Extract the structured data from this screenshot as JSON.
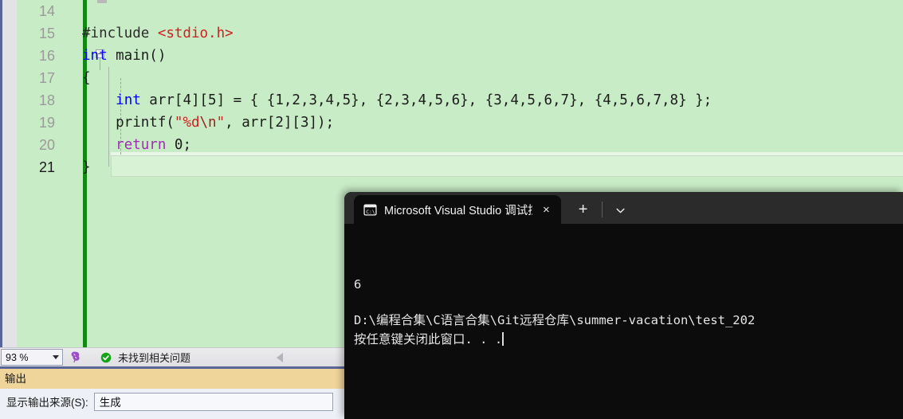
{
  "editor": {
    "name": "visual-studio-code-editor",
    "background_color": "#c8ecc5",
    "change_bar_color": "#128a12",
    "lines": [
      {
        "number": "14",
        "active": false,
        "tokens": []
      },
      {
        "number": "15",
        "active": false,
        "tokens": [
          {
            "t": "#include ",
            "c": "pp"
          },
          {
            "t": "<stdio.h>",
            "c": "red"
          }
        ]
      },
      {
        "number": "16",
        "active": false,
        "tokens": [
          {
            "t": "int",
            "c": "blue"
          },
          {
            "t": " main()",
            "c": "plain"
          }
        ]
      },
      {
        "number": "17",
        "active": false,
        "tokens": [
          {
            "t": "{",
            "c": "plain"
          }
        ]
      },
      {
        "number": "18",
        "active": false,
        "tokens": [
          {
            "t": "    ",
            "c": "plain"
          },
          {
            "t": "int",
            "c": "blue"
          },
          {
            "t": " arr[4][5] = { {1,2,3,4,5}, {2,3,4,5,6}, {3,4,5,6,7}, {4,5,6,7,8} };",
            "c": "plain"
          }
        ]
      },
      {
        "number": "19",
        "active": false,
        "tokens": [
          {
            "t": "    printf(",
            "c": "plain"
          },
          {
            "t": "\"%d",
            "c": "red"
          },
          {
            "t": "\\n",
            "c": "esc"
          },
          {
            "t": "\"",
            "c": "red"
          },
          {
            "t": ", arr[2][3]);",
            "c": "plain"
          }
        ]
      },
      {
        "number": "20",
        "active": false,
        "tokens": [
          {
            "t": "    ",
            "c": "plain"
          },
          {
            "t": "return",
            "c": "purple"
          },
          {
            "t": " 0;",
            "c": "plain"
          }
        ]
      },
      {
        "number": "21",
        "active": true,
        "tokens": [
          {
            "t": "}",
            "c": "plain"
          }
        ]
      }
    ]
  },
  "statusbar": {
    "zoom_value": "93 %",
    "brain_icon": "intellicode-brain-icon",
    "status_icon": "green-check-circle-icon",
    "status_text": "未找到相关问题",
    "nav_arrow_icon": "left-triangle-icon"
  },
  "output_panel": {
    "tab_label": "输出",
    "tab_color": "#f0d59a",
    "source_label": "显示输出来源(S):",
    "source_value": "生成"
  },
  "console": {
    "tab_icon": "command-prompt-icon",
    "tab_title": "Microsoft Visual Studio 调试控",
    "close_icon": "×",
    "new_tab_icon": "+",
    "dropdown_icon": "chevron-down-icon",
    "output_lines": [
      "6",
      "",
      "D:\\编程合集\\C语言合集\\Git远程仓库\\summer-vacation\\test_202",
      "按任意键关闭此窗口. . ."
    ]
  }
}
